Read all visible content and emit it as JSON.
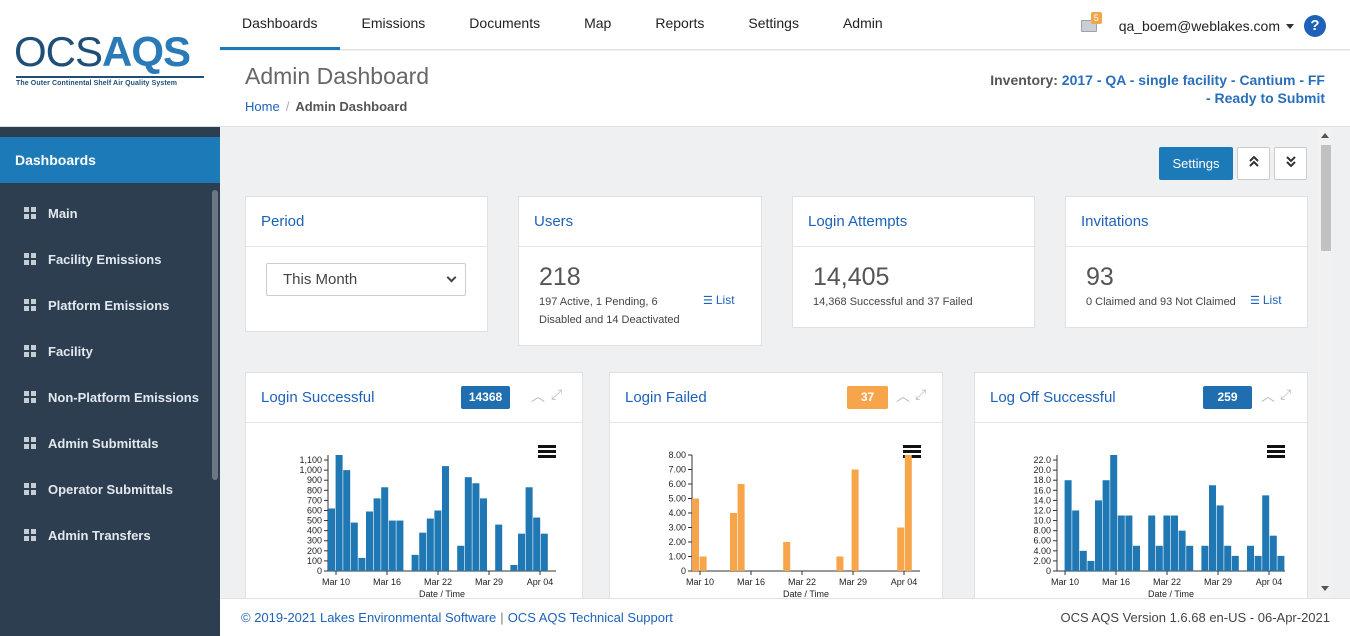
{
  "logo": {
    "text_light": "OCS",
    "text_bold": "AQS",
    "tagline": "The Outer Continental Shelf Air Quality System"
  },
  "sidebar": {
    "heading": "Dashboards",
    "items": [
      {
        "label": "Main"
      },
      {
        "label": "Facility Emissions"
      },
      {
        "label": "Platform Emissions"
      },
      {
        "label": "Facility"
      },
      {
        "label": "Non-Platform Emissions"
      },
      {
        "label": "Admin Submittals"
      },
      {
        "label": "Operator Submittals"
      },
      {
        "label": "Admin Transfers"
      }
    ]
  },
  "nav": {
    "items": [
      "Dashboards",
      "Emissions",
      "Documents",
      "Map",
      "Reports",
      "Settings",
      "Admin"
    ],
    "active": "Dashboards"
  },
  "user": {
    "mail_count": "5",
    "email": "qa_boem@weblakes.com",
    "help": "?"
  },
  "header": {
    "title": "Admin Dashboard",
    "breadcrumb": {
      "home": "Home",
      "current": "Admin Dashboard"
    },
    "inventory_label": "Inventory:",
    "inventory_value_1": "2017 - QA - single facility - Cantium - FF",
    "inventory_value_2": "- Ready to Submit"
  },
  "toolbar": {
    "settings_label": "Settings",
    "collapse_all": "⌃",
    "expand_all": "⌄"
  },
  "cards": {
    "period": {
      "title": "Period",
      "selected": "This Month"
    },
    "users": {
      "title": "Users",
      "count": "218",
      "detail_1": "197 Active, 1 Pending, 6",
      "detail_2": "Disabled and 14 Deactivated",
      "link": "List"
    },
    "login_attempts": {
      "title": "Login Attempts",
      "count": "14,405",
      "detail": "14,368 Successful and 37 Failed"
    },
    "invitations": {
      "title": "Invitations",
      "count": "93",
      "detail": "0 Claimed and 93 Not Claimed",
      "link": "List"
    }
  },
  "panels": {
    "login_successful": {
      "title": "Login Successful",
      "badge": "14368",
      "color": "#1f77b4"
    },
    "login_failed": {
      "title": "Login Failed",
      "badge": "37",
      "color": "#f7a54a"
    },
    "log_off_successful": {
      "title": "Log Off Successful",
      "badge": "259",
      "color": "#1f77b4"
    }
  },
  "chart_data": [
    {
      "type": "bar",
      "title": "Login Successful",
      "xlabel": "Date / Time",
      "x_ticks": [
        "Mar 10",
        "Mar 16",
        "Mar 22",
        "Mar 29",
        "Apr 04"
      ],
      "y_ticks": [
        "0",
        "100",
        "200",
        "300",
        "400",
        "500",
        "600",
        "700",
        "800",
        "900",
        "1,000",
        "1,100"
      ],
      "ylim": [
        0,
        1150
      ],
      "values": [
        620,
        1150,
        1000,
        480,
        130,
        590,
        720,
        830,
        500,
        500,
        0,
        160,
        380,
        520,
        600,
        1040,
        0,
        250,
        930,
        870,
        720,
        0,
        460,
        0,
        60,
        370,
        830,
        530,
        370,
        0
      ],
      "color": "#1f77b4"
    },
    {
      "type": "bar",
      "title": "Login Failed",
      "xlabel": "Date / Time",
      "x_ticks": [
        "Mar 10",
        "Mar 16",
        "Mar 22",
        "Mar 29",
        "Apr 04"
      ],
      "y_ticks": [
        "0",
        "1.00",
        "2.00",
        "3.00",
        "4.00",
        "5.00",
        "6.00",
        "7.00",
        "8.00"
      ],
      "ylim": [
        0,
        8
      ],
      "values": [
        5,
        1,
        0,
        0,
        0,
        4,
        6,
        0,
        0,
        0,
        0,
        0,
        2,
        0,
        0,
        0,
        0,
        0,
        0,
        1,
        0,
        7,
        0,
        0,
        0,
        0,
        0,
        3,
        8,
        0
      ],
      "color": "#f7a54a"
    },
    {
      "type": "bar",
      "title": "Log Off Successful",
      "xlabel": "Date / Time",
      "x_ticks": [
        "Mar 10",
        "Mar 16",
        "Mar 22",
        "Mar 29",
        "Apr 04"
      ],
      "y_ticks": [
        "0",
        "2.00",
        "4.00",
        "6.00",
        "8.00",
        "10.0",
        "12.0",
        "14.0",
        "16.0",
        "18.0",
        "20.0",
        "22.0"
      ],
      "ylim": [
        0,
        23
      ],
      "values": [
        0,
        18,
        12,
        4,
        2,
        14,
        18,
        23,
        11,
        11,
        5,
        0,
        11,
        5,
        11,
        11,
        8,
        5,
        0,
        5,
        17,
        13,
        5,
        3,
        0,
        5,
        3,
        15,
        7,
        3
      ],
      "color": "#1f77b4"
    }
  ],
  "footer": {
    "copyright": "© 2019-2021 Lakes Environmental Software",
    "support": "OCS AQS Technical Support",
    "version": "OCS AQS Version 1.6.68 en-US - 06-Apr-2021"
  }
}
